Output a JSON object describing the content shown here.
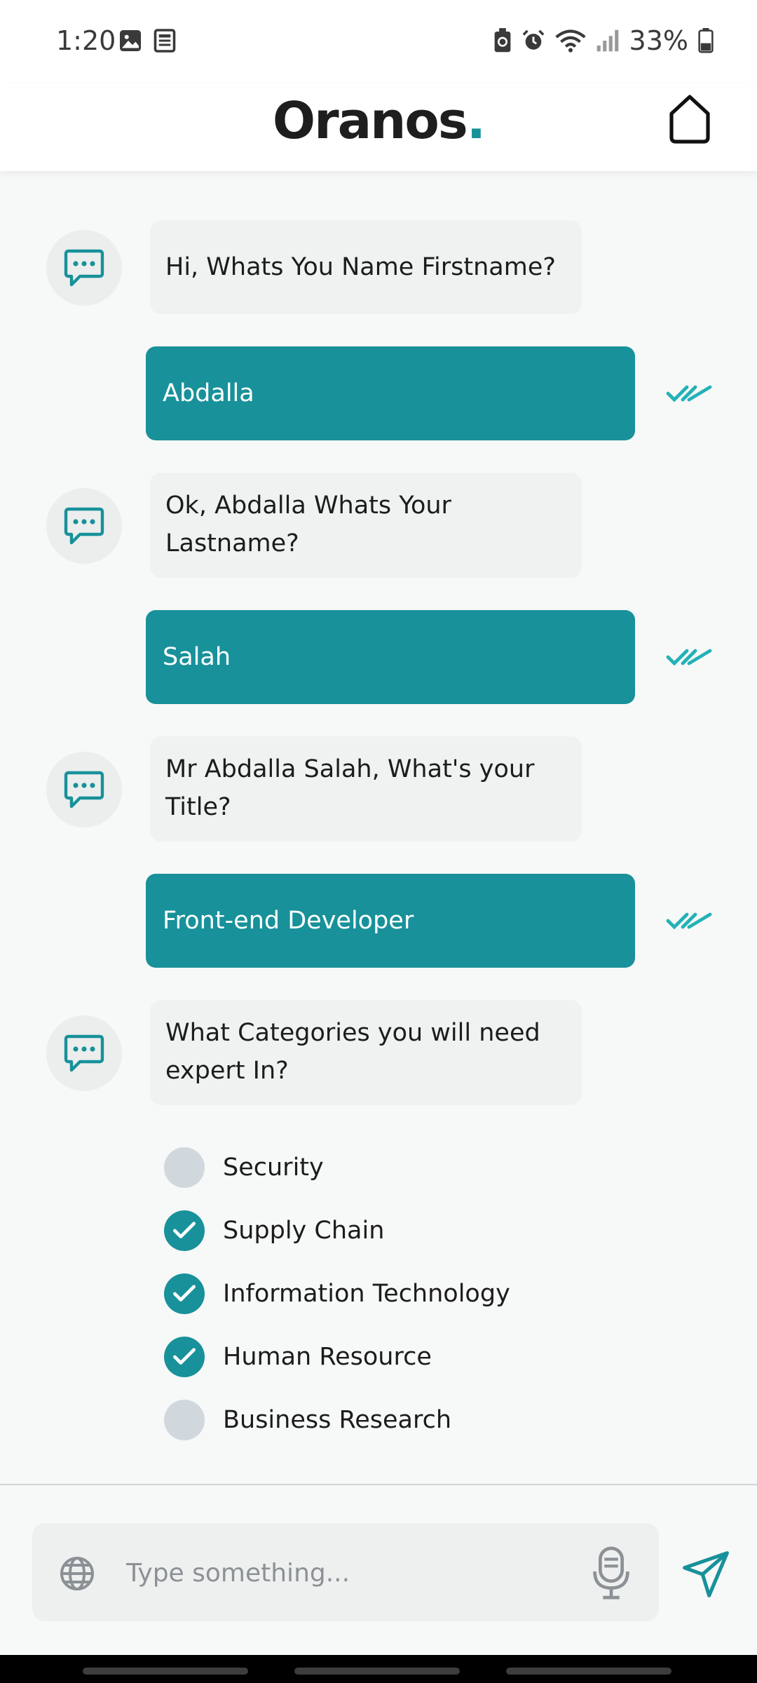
{
  "status_bar": {
    "time": "1:20",
    "battery_percent": "33%",
    "left_icons": [
      "image-icon",
      "news-icon"
    ],
    "right_icons": [
      "battery-saver-icon",
      "alarm-icon",
      "wifi-icon",
      "signal-icon",
      "battery-icon"
    ]
  },
  "header": {
    "brand_name": "Oranos",
    "brand_dot": ".",
    "home_icon": "home-icon"
  },
  "messages": [
    {
      "from": "bot",
      "text": "Hi, Whats You Name Firstname?"
    },
    {
      "from": "user",
      "text": "Abdalla",
      "status": "read"
    },
    {
      "from": "bot",
      "text": "Ok, Abdalla Whats Your Lastname?"
    },
    {
      "from": "user",
      "text": "Salah",
      "status": "read"
    },
    {
      "from": "bot",
      "text": "Mr Abdalla Salah, What's your Title?"
    },
    {
      "from": "user",
      "text": "Front-end Developer",
      "status": "read"
    },
    {
      "from": "bot",
      "text": "What Categories you will need expert In?"
    }
  ],
  "categories": [
    {
      "label": "Security",
      "checked": false
    },
    {
      "label": "Supply Chain",
      "checked": true
    },
    {
      "label": "Information Technology",
      "checked": true
    },
    {
      "label": "Human Resource",
      "checked": true
    },
    {
      "label": "Business Research",
      "checked": false
    }
  ],
  "composer": {
    "placeholder": "Type something...",
    "value": ""
  },
  "colors": {
    "accent": "#18919A",
    "check": "#22B2B7",
    "bot_bubble": "#F0F2F2",
    "unchecked": "#D1D8DD"
  }
}
